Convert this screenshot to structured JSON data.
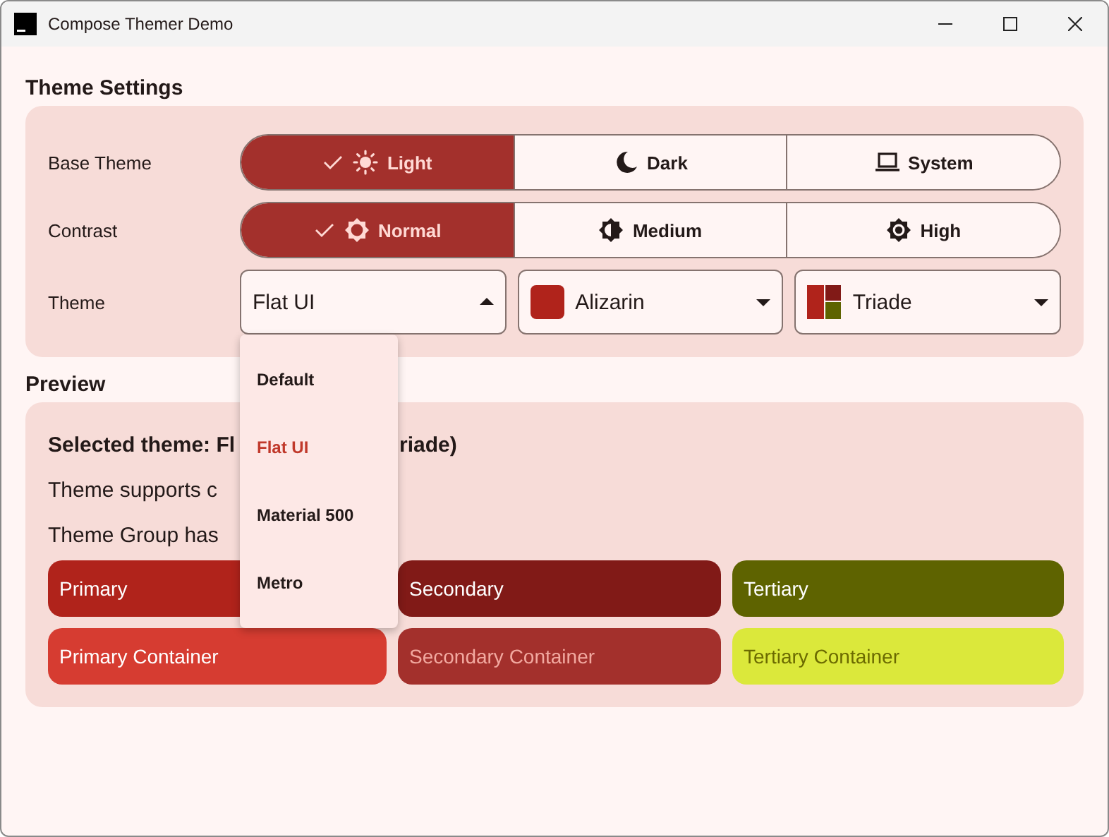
{
  "window": {
    "title": "Compose Themer Demo"
  },
  "settings": {
    "title": "Theme Settings",
    "segments": [
      {
        "label": "Base Theme",
        "options": [
          {
            "label": "Light",
            "selected": true
          },
          {
            "label": "Dark",
            "selected": false
          },
          {
            "label": "System",
            "selected": false
          }
        ]
      },
      {
        "label": "Contrast",
        "options": [
          {
            "label": "Normal",
            "selected": true
          },
          {
            "label": "Medium",
            "selected": false
          },
          {
            "label": "High",
            "selected": false
          }
        ]
      }
    ],
    "theme_label": "Theme",
    "dropdowns": [
      {
        "value": "Flat UI",
        "expanded": true
      },
      {
        "value": "Alizarin",
        "expanded": false,
        "swatches": [
          {
            "color": "#b0231b"
          }
        ]
      },
      {
        "value": "Triade",
        "expanded": false,
        "swatches": [
          {
            "color": "#b0231b"
          },
          {
            "color": "#811a17"
          },
          {
            "color": "#5e6300"
          }
        ]
      }
    ]
  },
  "menu": {
    "items": [
      {
        "label": "Default",
        "selected": false
      },
      {
        "label": "Flat UI",
        "selected": true
      },
      {
        "label": "Material 500",
        "selected": false
      },
      {
        "label": "Metro",
        "selected": false
      }
    ]
  },
  "preview": {
    "title": "Preview",
    "lines": [
      {
        "before": "Selected theme: Fl",
        "after": "riade)",
        "bold": true
      },
      {
        "before": "Theme supports c",
        "bold": false
      },
      {
        "before": "Theme Group has",
        "bold": false
      }
    ],
    "swatches": [
      {
        "label": "Primary",
        "color": "#b0231b"
      },
      {
        "label": "Secondary",
        "color": "#811a17"
      },
      {
        "label": "Tertiary",
        "color": "#5e6300"
      },
      {
        "label": "Primary Container",
        "color": "#d63c31"
      },
      {
        "label": "Secondary Container",
        "color": "#a3302c"
      },
      {
        "label": "Tertiary Container",
        "color": "#dbe83b"
      }
    ]
  }
}
